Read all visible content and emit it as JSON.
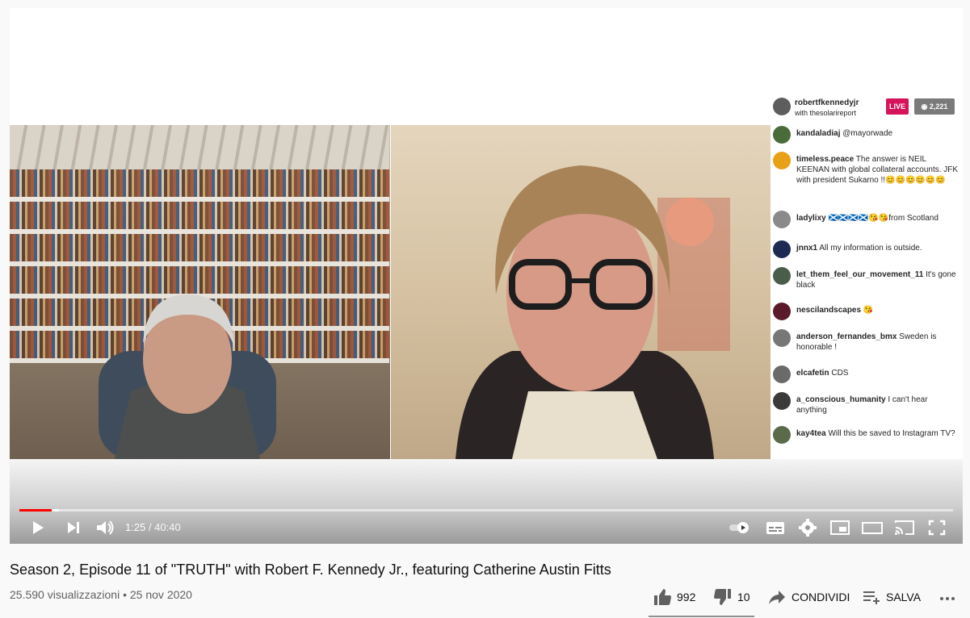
{
  "video": {
    "overlay": {
      "host_name": "robertfkennedyjr",
      "host_sub": "with thesolarireport",
      "live_label": "LIVE",
      "viewer_count": "2,221",
      "comments": [
        {
          "user": "kandaladiaj",
          "text": "@mayorwade"
        },
        {
          "user": "timeless.peace",
          "text": "The answer is NEIL KEENAN with global collateral accounts. JFK with president Sukarno !!😊😊😊😊😊😊"
        },
        {
          "user": "ladylixy",
          "text": "🏴󠁧󠁢󠁳󠁣󠁴󠁿🏴󠁧󠁢󠁳󠁣󠁴󠁿🏴󠁧󠁢󠁳󠁣󠁴󠁿🏴󠁧󠁢󠁳󠁣󠁴󠁿😘😘from Scotland"
        },
        {
          "user": "jnnx1",
          "text": "All my information is outside."
        },
        {
          "user": "let_them_feel_our_movement_11",
          "text": "It's gone black"
        },
        {
          "user": "nescilandscapes",
          "text": "😘"
        },
        {
          "user": "anderson_fernandes_bmx",
          "text": "Sweden is honorable !"
        },
        {
          "user": "elcafetin",
          "text": "CDS"
        },
        {
          "user": "a_conscious_humanity",
          "text": "I can't hear anything"
        },
        {
          "user": "kay4tea",
          "text": "Will this be saved to Instagram TV?"
        }
      ],
      "avatar_colors": [
        "#4a6b3a",
        "#e8a017",
        "#8a8a8a",
        "#1d2a52",
        "#4a5d4a",
        "#5a1a2a",
        "#777777",
        "#6a6a6a",
        "#3a3a3a",
        "#5a6a4a"
      ]
    },
    "progress": {
      "played_fraction": 0.0347,
      "loaded_fraction": 0.042
    },
    "time_current": "1:25",
    "time_separator": " / ",
    "time_duration": "40:40"
  },
  "info": {
    "title": "Season 2, Episode 11 of \"TRUTH\" with Robert F. Kennedy Jr., featuring Catherine Austin Fitts",
    "views": "25.590 visualizzazioni",
    "dot": " • ",
    "date": "25 nov 2020",
    "likes": "992",
    "dislikes": "10",
    "share_label": "CONDIVIDI",
    "save_label": "SALVA"
  },
  "colors": {
    "accent": "#ff0000",
    "live": "#d6145c"
  }
}
